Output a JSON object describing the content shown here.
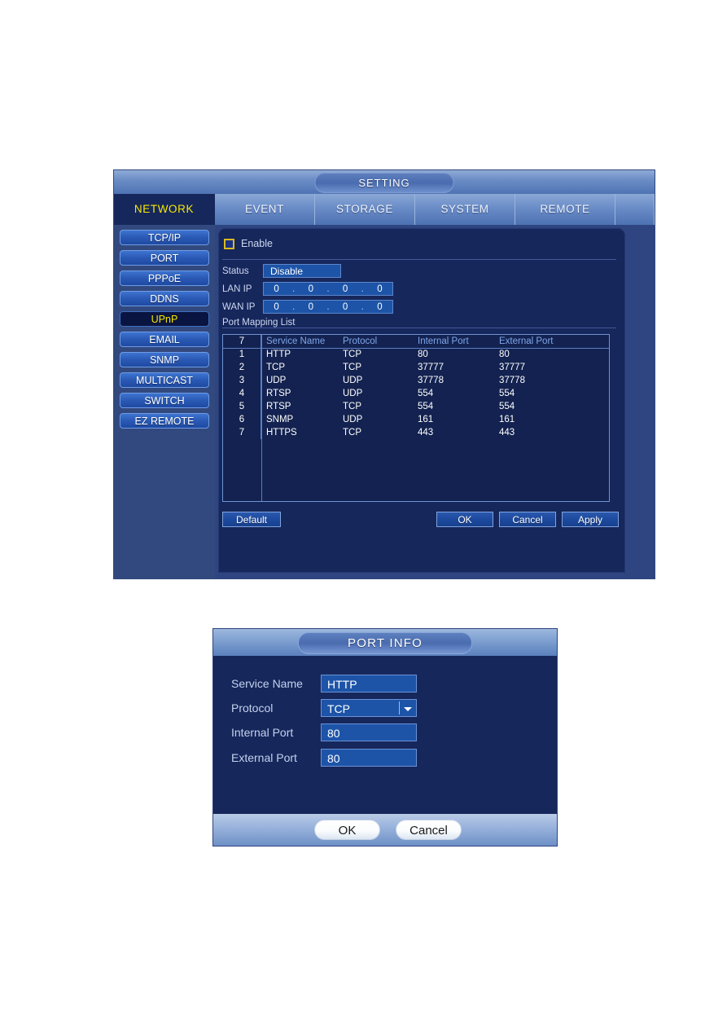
{
  "setting_window": {
    "title": "SETTING",
    "tabs": [
      {
        "label": "NETWORK",
        "active": true
      },
      {
        "label": "EVENT",
        "active": false
      },
      {
        "label": "STORAGE",
        "active": false
      },
      {
        "label": "SYSTEM",
        "active": false
      },
      {
        "label": "REMOTE",
        "active": false
      }
    ],
    "sidebar": {
      "items": [
        {
          "label": "TCP/IP",
          "selected": false
        },
        {
          "label": "PORT",
          "selected": false
        },
        {
          "label": "PPPoE",
          "selected": false
        },
        {
          "label": "DDNS",
          "selected": false
        },
        {
          "label": "UPnP",
          "selected": true
        },
        {
          "label": "EMAIL",
          "selected": false
        },
        {
          "label": "SNMP",
          "selected": false
        },
        {
          "label": "MULTICAST",
          "selected": false
        },
        {
          "label": "SWITCH",
          "selected": false
        },
        {
          "label": "EZ REMOTE",
          "selected": false
        }
      ]
    },
    "form": {
      "enable_label": "Enable",
      "enable_checked": false,
      "status_label": "Status",
      "status_value": "Disable",
      "lan_ip_label": "LAN IP",
      "lan_ip": [
        "0",
        "0",
        "0",
        "0"
      ],
      "wan_ip_label": "WAN IP",
      "wan_ip": [
        "0",
        "0",
        "0",
        "0"
      ],
      "port_mapping_label": "Port Mapping List"
    },
    "table": {
      "headers": {
        "index": "7",
        "service_name": "Service Name",
        "protocol": "Protocol",
        "internal_port": "Internal Port",
        "external_port": "External Port"
      },
      "rows": [
        {
          "index": "1",
          "service_name": "HTTP",
          "protocol": "TCP",
          "internal_port": "80",
          "external_port": "80"
        },
        {
          "index": "2",
          "service_name": "TCP",
          "protocol": "TCP",
          "internal_port": "37777",
          "external_port": "37777"
        },
        {
          "index": "3",
          "service_name": "UDP",
          "protocol": "UDP",
          "internal_port": "37778",
          "external_port": "37778"
        },
        {
          "index": "4",
          "service_name": "RTSP",
          "protocol": "UDP",
          "internal_port": "554",
          "external_port": "554"
        },
        {
          "index": "5",
          "service_name": "RTSP",
          "protocol": "TCP",
          "internal_port": "554",
          "external_port": "554"
        },
        {
          "index": "6",
          "service_name": "SNMP",
          "protocol": "UDP",
          "internal_port": "161",
          "external_port": "161"
        },
        {
          "index": "7",
          "service_name": "HTTPS",
          "protocol": "TCP",
          "internal_port": "443",
          "external_port": "443"
        }
      ]
    },
    "buttons": {
      "default": "Default",
      "ok": "OK",
      "cancel": "Cancel",
      "apply": "Apply"
    }
  },
  "port_info_dialog": {
    "title": "PORT INFO",
    "fields": {
      "service_name_label": "Service Name",
      "service_name_value": "HTTP",
      "protocol_label": "Protocol",
      "protocol_value": "TCP",
      "internal_port_label": "Internal Port",
      "internal_port_value": "80",
      "external_port_label": "External Port",
      "external_port_value": "80"
    },
    "buttons": {
      "ok": "OK",
      "cancel": "Cancel"
    }
  },
  "colors": {
    "accent_yellow": "#f5e800",
    "panel_navy": "#16275c",
    "sidebar_blue": "#32497f",
    "field_blue": "#1d54a8"
  }
}
